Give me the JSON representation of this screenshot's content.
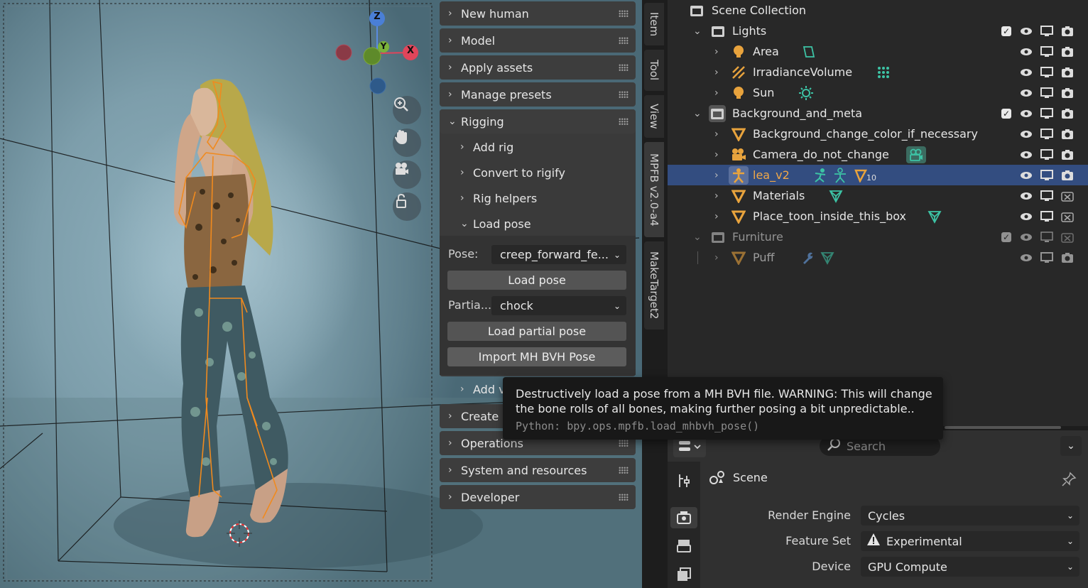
{
  "npanel": {
    "sections": [
      "New human",
      "Model",
      "Apply assets",
      "Manage presets",
      "Rigging"
    ],
    "rigging_sub": [
      "Add rig",
      "Convert to rigify",
      "Rig helpers",
      "Load pose"
    ],
    "pose_label": "Pose:",
    "pose_value": "creep_forward_fe...",
    "load_pose_btn": "Load pose",
    "partial_label": "Partia...",
    "partial_value": "chock",
    "load_partial_btn": "Load partial pose",
    "import_bvh_btn": "Import MH BVH Pose",
    "add_sub": "Add v",
    "lower_sections": [
      "Create a",
      "Operations",
      "System and resources",
      "Developer"
    ]
  },
  "vtabs": [
    "Item",
    "Tool",
    "View",
    "MPFB v2.0-a4",
    "MakeTarget2"
  ],
  "tooltip": {
    "line1": "Destructively load a pose from a MH BVH file. WARNING: This will change",
    "line2": "the bone rolls of all bones, making further posing a bit unpredictable..",
    "python": "Python: bpy.ops.mpfb.load_mhbvh_pose()"
  },
  "outliner": {
    "root": "Scene Collection",
    "rows": [
      "Lights",
      "Area",
      "IrradianceVolume",
      "Sun",
      "Background_and_meta",
      "Background_change_color_if_necessary",
      "Camera_do_not_change",
      "lea_v2",
      "Materials",
      "Place_toon_inside_this_box",
      "Furniture",
      "Puff"
    ],
    "lea_badge": "10"
  },
  "properties": {
    "search_placeholder": "Search",
    "context": "Scene",
    "render_engine_label": "Render Engine",
    "render_engine_value": "Cycles",
    "feature_set_label": "Feature Set",
    "feature_set_value": "Experimental",
    "device_label": "Device",
    "device_value": "GPU Compute"
  },
  "gizmo": {
    "z": "Z",
    "y": "Y",
    "x": "X"
  },
  "colors": {
    "accent_selected": "#334d80",
    "orange": "#e8a33d",
    "teal": "#3dc3a5"
  }
}
